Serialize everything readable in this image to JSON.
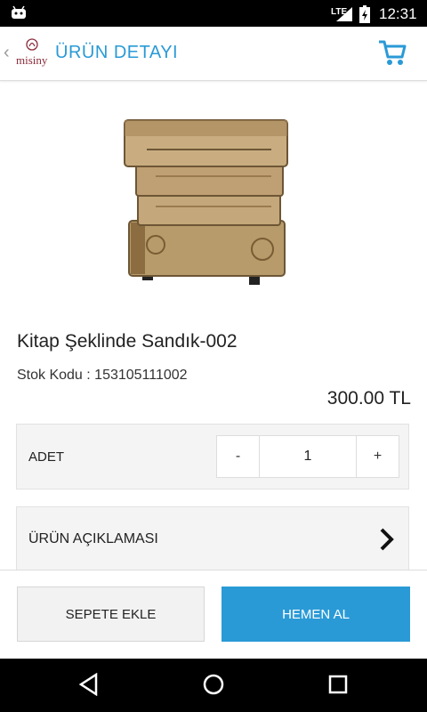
{
  "status_bar": {
    "time": "12:31",
    "network": "LTE"
  },
  "app_bar": {
    "back_glyph": "‹",
    "logo_text": "misiny",
    "title": "ÜRÜN DETAYI",
    "accent": "#2a9ad6"
  },
  "product": {
    "name": "Kitap Şeklinde Sandık-002",
    "stock_code": "Stok Kodu : 153105111002",
    "price": "300.00 TL"
  },
  "quantity": {
    "label": "ADET",
    "minus": "-",
    "value": "1",
    "plus": "+"
  },
  "description": {
    "label": "ÜRÜN AÇIKLAMASI"
  },
  "actions": {
    "add_to_cart": "SEPETE EKLE",
    "buy_now": "HEMEN AL"
  }
}
